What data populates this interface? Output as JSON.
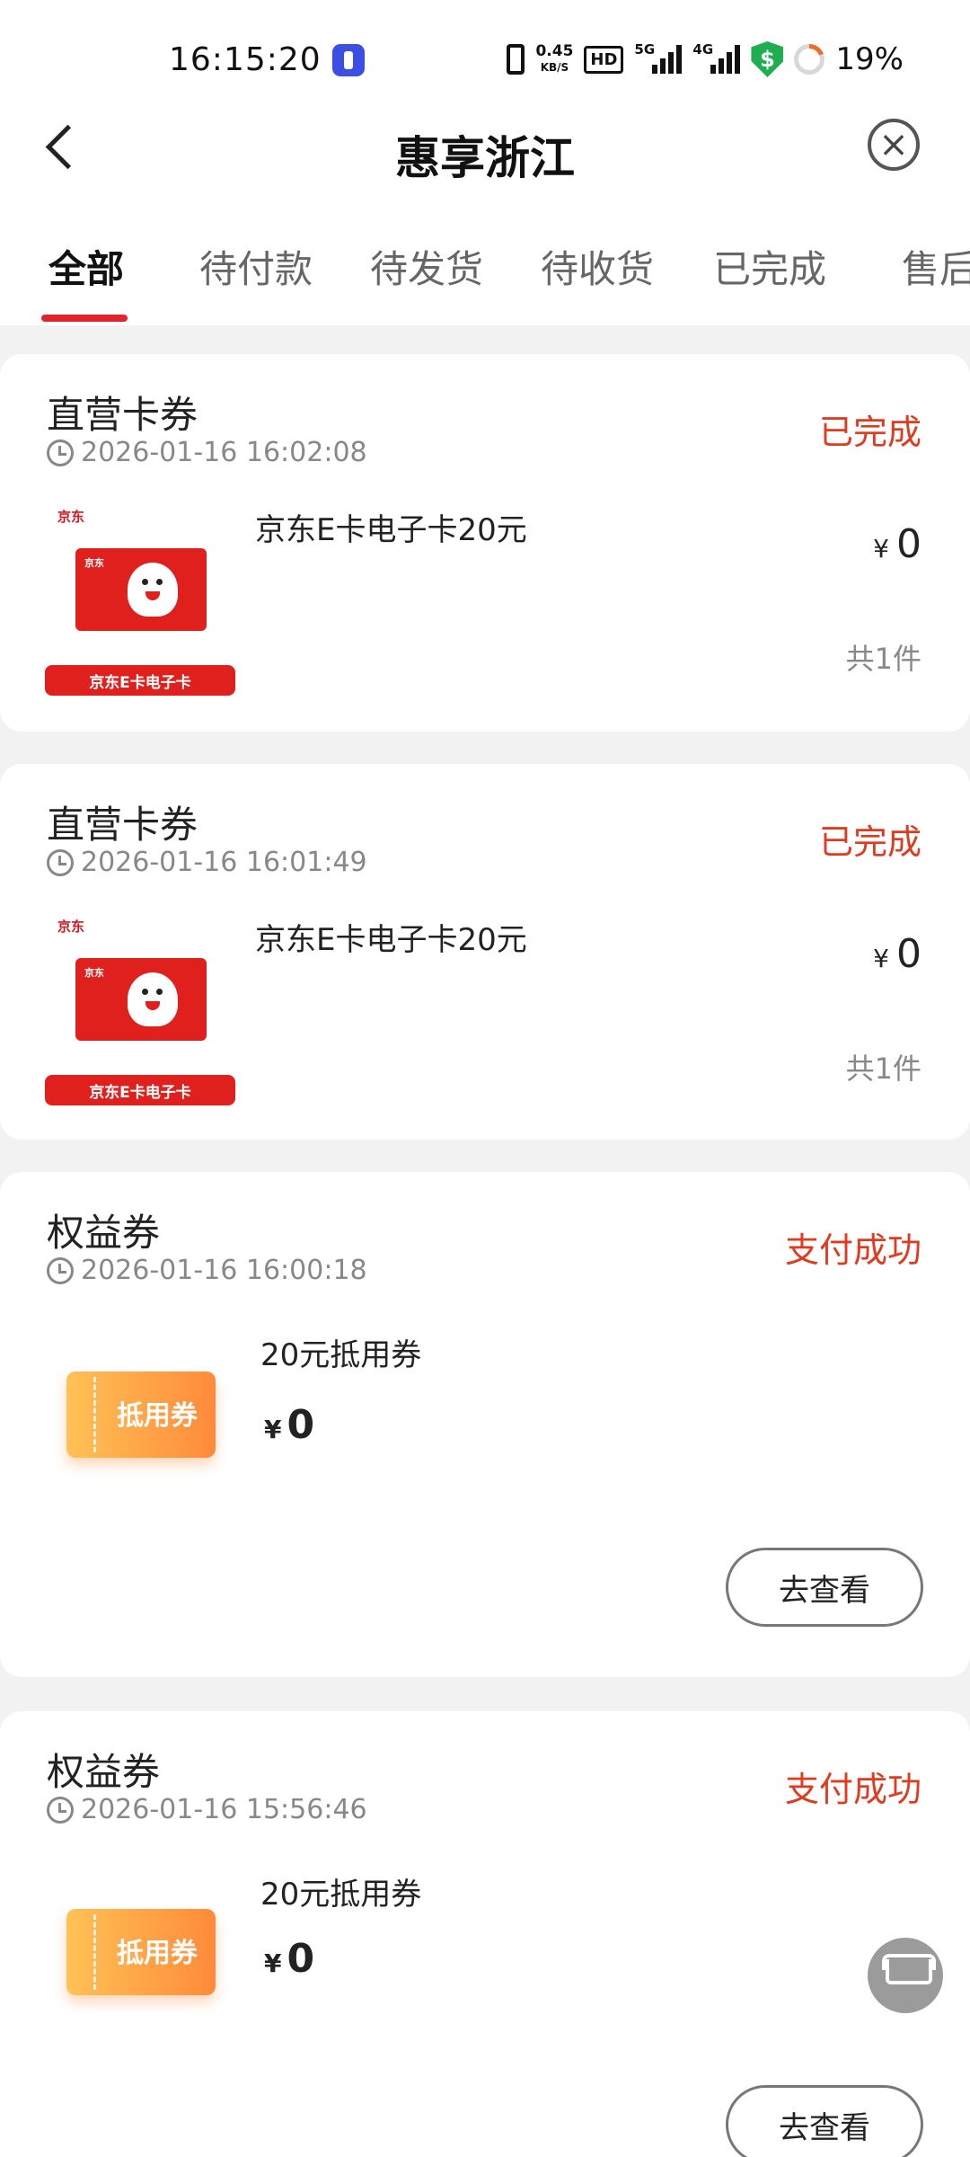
{
  "status_bar": {
    "time": "16:15:20",
    "net_speed_value": "0.45",
    "net_speed_unit": "KB/S",
    "hd": "HD",
    "signal1": "5G",
    "signal2": "4G",
    "shield_symbol": "$",
    "battery": "19%"
  },
  "header": {
    "title": "惠享浙江",
    "back_icon": "chevron-left-icon",
    "close_icon": "close-circle-icon"
  },
  "tabs": [
    {
      "label": "全部",
      "active": true
    },
    {
      "label": "待付款"
    },
    {
      "label": "待发货"
    },
    {
      "label": "待收货"
    },
    {
      "label": "已完成"
    },
    {
      "label": "售后"
    }
  ],
  "orders": [
    {
      "store": "直营卡券",
      "time": "2026-01-16 16:02:08",
      "status": "已完成",
      "product": "京东E卡电子卡20元",
      "thumb_brand": "京东",
      "thumb_label": "京东E卡电子卡",
      "currency": "¥",
      "price": "0",
      "qty": "共1件"
    },
    {
      "store": "直营卡券",
      "time": "2026-01-16 16:01:49",
      "status": "已完成",
      "product": "京东E卡电子卡20元",
      "thumb_brand": "京东",
      "thumb_label": "京东E卡电子卡",
      "currency": "¥",
      "price": "0",
      "qty": "共1件"
    },
    {
      "store": "权益券",
      "time": "2026-01-16 16:00:18",
      "status": "支付成功",
      "product": "20元抵用券",
      "thumb_label": "抵用券",
      "currency": "¥",
      "price": "0",
      "action": "去查看"
    },
    {
      "store": "权益券",
      "time": "2026-01-16 15:56:46",
      "status": "支付成功",
      "product": "20元抵用券",
      "thumb_label": "抵用券",
      "currency": "¥",
      "price": "0",
      "action": "去查看"
    }
  ],
  "colors": {
    "accent": "#e1252f",
    "status_text": "#e23a1f",
    "background": "#f2f2f2"
  }
}
